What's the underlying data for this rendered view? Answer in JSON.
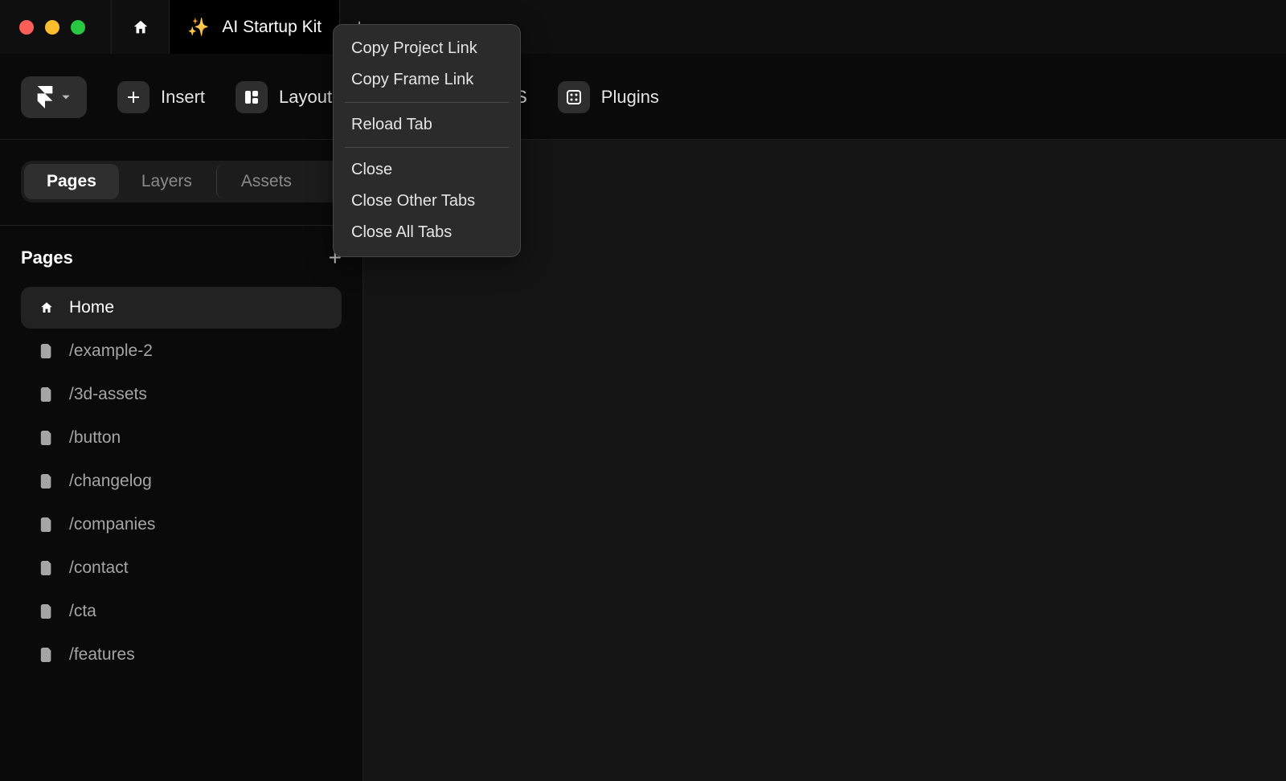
{
  "titlebar": {
    "project_name": "AI Startup Kit"
  },
  "toolbar": {
    "insert": "Insert",
    "layout": "Layout",
    "cms": "S",
    "plugins": "Plugins"
  },
  "sidebar_tabs": {
    "pages": "Pages",
    "layers": "Layers",
    "assets": "Assets"
  },
  "pages_section": {
    "title": "Pages"
  },
  "pages": {
    "p0": "Home",
    "p1": "/example-2",
    "p2": "/3d-assets",
    "p3": "/button",
    "p4": "/changelog",
    "p5": "/companies",
    "p6": "/contact",
    "p7": "/cta",
    "p8": "/features"
  },
  "context_menu": {
    "copy_project": "Copy Project Link",
    "copy_frame": "Copy Frame Link",
    "reload": "Reload Tab",
    "close": "Close",
    "close_other": "Close Other Tabs",
    "close_all": "Close All Tabs"
  }
}
